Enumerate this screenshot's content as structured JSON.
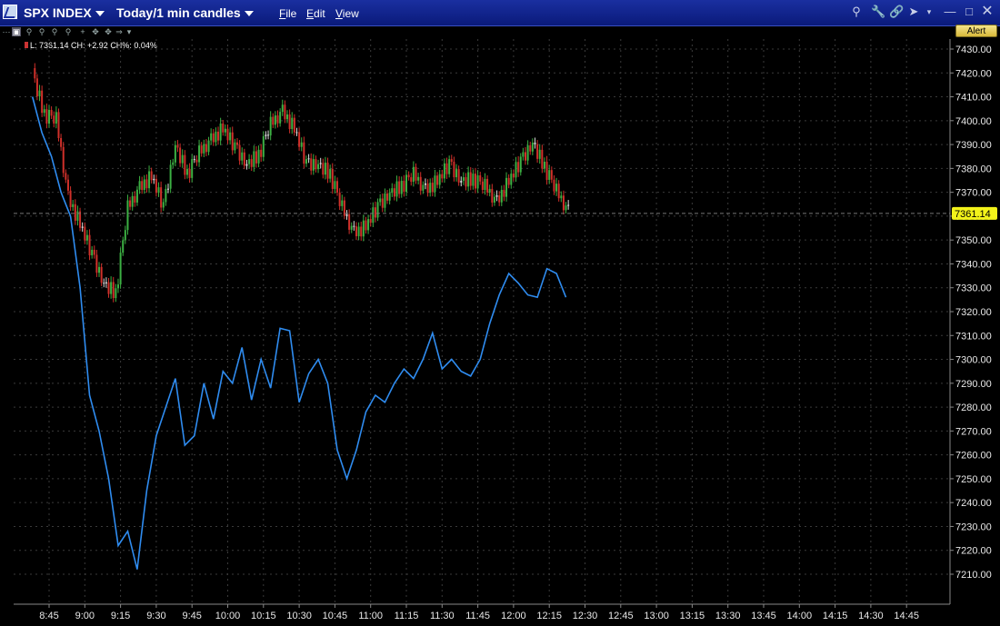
{
  "window": {
    "symbol": "SPX INDEX",
    "period": "Today/1 min candles",
    "menu": [
      {
        "label": "File",
        "ul": "F"
      },
      {
        "label": "Edit",
        "ul": "E"
      },
      {
        "label": "View",
        "ul": "V"
      }
    ],
    "alert_label": "Alert"
  },
  "legend": {
    "text": "L: 7361.14 CH: +2.92 CH%: 0.04%"
  },
  "last_price_label": "7361.14",
  "colors": {
    "titlebar": "#0a1a7a",
    "up_candle": "#3cb043",
    "down_candle": "#d0302a",
    "neutral_candle": "#dcdcdc",
    "overlay_line": "#2f8cf0",
    "price_tag": "#f2f21a",
    "grid": "#3a3a3a"
  },
  "chart_data": {
    "type": "line",
    "y_axis_ticks": [
      "7430.00",
      "7420.00",
      "7410.00",
      "7400.00",
      "7390.00",
      "7380.00",
      "7370.00",
      "7360.00",
      "7350.00",
      "7340.00",
      "7330.00",
      "7320.00",
      "7310.00",
      "7300.00",
      "7290.00",
      "7280.00",
      "7270.00",
      "7260.00",
      "7250.00",
      "7240.00",
      "7230.00",
      "7220.00",
      "7210.00"
    ],
    "x_axis_ticks": [
      "8:45",
      "9:00",
      "9:15",
      "9:30",
      "9:45",
      "10:00",
      "10:15",
      "10:30",
      "10:45",
      "11:00",
      "11:15",
      "11:30",
      "11:45",
      "12:00",
      "12:15",
      "12:30",
      "12:45",
      "13:00",
      "13:15",
      "13:30",
      "13:45",
      "14:00",
      "14:15",
      "14:30",
      "14:45"
    ],
    "ylim": [
      7205,
      7435
    ],
    "last_price": 7361.14,
    "series": [
      {
        "kind": "candles",
        "x_minutes_from_start": [
          0,
          5,
          10,
          15,
          20,
          25,
          30,
          35,
          40,
          45,
          50,
          55,
          60,
          65,
          70,
          75,
          80,
          85,
          90,
          95,
          100,
          105,
          110,
          115,
          120,
          125,
          130,
          135,
          140,
          145,
          150,
          155,
          160,
          165,
          170,
          175,
          180,
          185,
          190,
          195,
          200,
          205,
          210,
          215,
          220,
          225
        ],
        "close": [
          7418,
          7403,
          7400,
          7368,
          7356,
          7345,
          7330,
          7328,
          7363,
          7372,
          7376,
          7365,
          7388,
          7378,
          7386,
          7392,
          7396,
          7390,
          7380,
          7386,
          7398,
          7404,
          7396,
          7383,
          7380,
          7378,
          7363,
          7353,
          7355,
          7365,
          7368,
          7373,
          7377,
          7371,
          7374,
          7383,
          7373,
          7376,
          7372,
          7366,
          7374,
          7384,
          7389,
          7381,
          7370,
          7362
        ]
      },
      {
        "kind": "line",
        "x_minutes_from_start": [
          0,
          4,
          8,
          12,
          16,
          20,
          24,
          28,
          32,
          36,
          40,
          44,
          48,
          52,
          56,
          60,
          64,
          68,
          72,
          76,
          80,
          84,
          88,
          92,
          96,
          100,
          104,
          108,
          112,
          116,
          120,
          124,
          128,
          132,
          136,
          140,
          144,
          148,
          152,
          156,
          160,
          164,
          168,
          172,
          176,
          180,
          184,
          188,
          192,
          196,
          200,
          204,
          208,
          212,
          216,
          220,
          224
        ],
        "value": [
          7410,
          7395,
          7385,
          7370,
          7360,
          7330,
          7285,
          7270,
          7250,
          7222,
          7228,
          7212,
          7245,
          7268,
          7280,
          7292,
          7264,
          7268,
          7290,
          7275,
          7295,
          7290,
          7305,
          7283,
          7300,
          7288,
          7313,
          7312,
          7282,
          7294,
          7300,
          7290,
          7262,
          7250,
          7262,
          7278,
          7285,
          7282,
          7290,
          7296,
          7292,
          7300,
          7311,
          7296,
          7300,
          7295,
          7293,
          7300,
          7315,
          7327,
          7336,
          7332,
          7327,
          7326,
          7338,
          7336,
          7326
        ]
      }
    ]
  }
}
